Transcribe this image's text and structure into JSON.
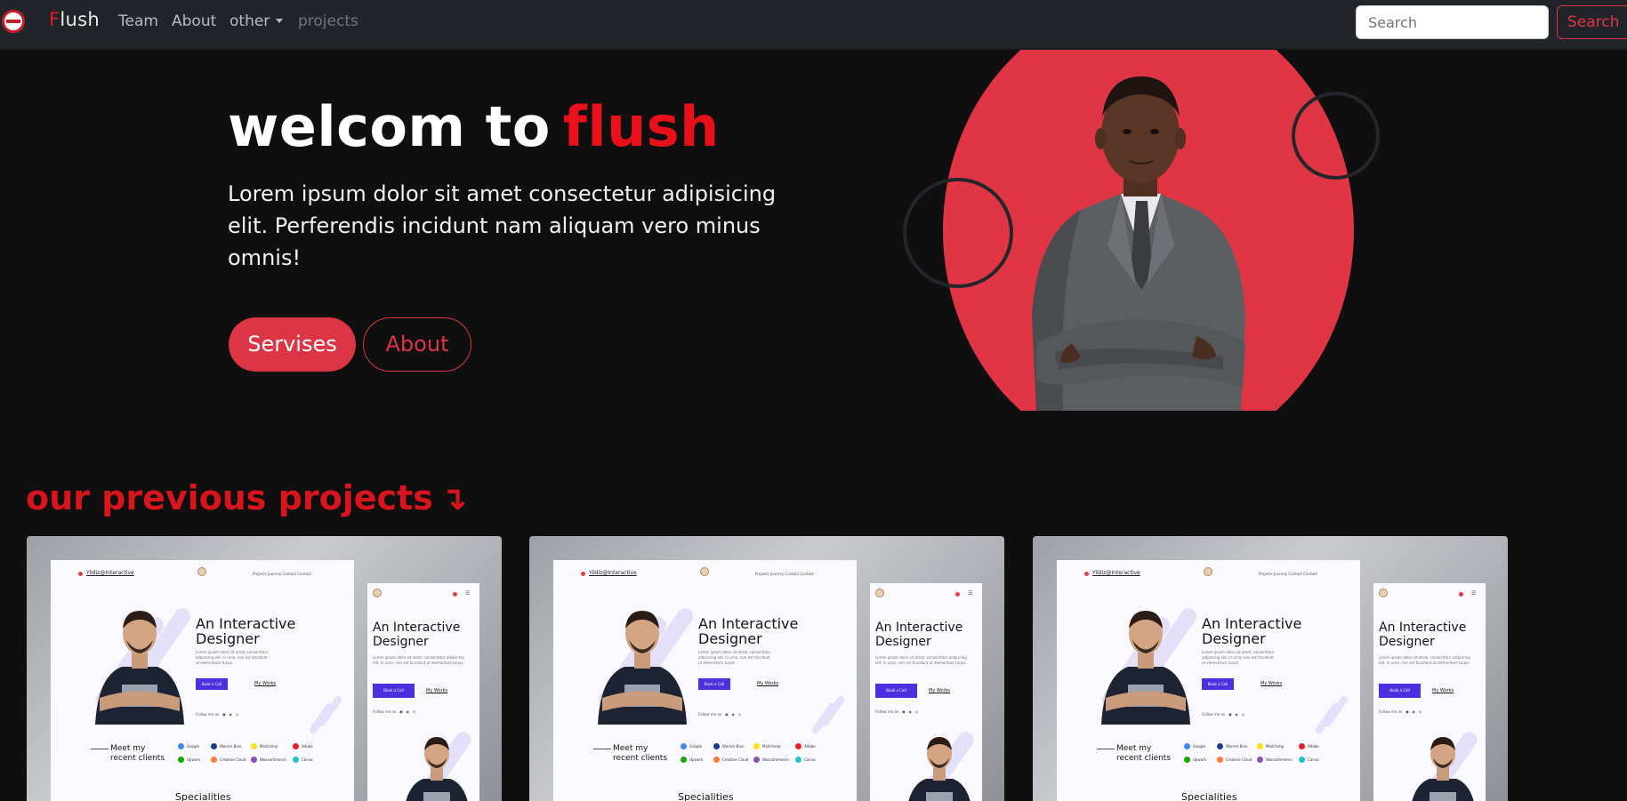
{
  "navbar": {
    "brand_first": "F",
    "brand_rest": "lush",
    "links": [
      "Team",
      "About",
      "other",
      "projects"
    ],
    "search_placeholder": "Search",
    "search_button": "Search"
  },
  "hero": {
    "title_main": "welcom to",
    "title_accent": "flush",
    "text": "Lorem ipsum dolor sit amet consectetur adipisicing elit. Perferendis incidunt nam aliquam vero minus omnis!",
    "primary_button": "Servises",
    "secondary_button": "About"
  },
  "projects": {
    "title": "our previous projects",
    "arrow": "↴",
    "card": {
      "logo": "Yildiz@Interactive",
      "nav": "Projects    Journey    Contact    Contact",
      "headline_1": "An Interactive",
      "headline_2": "Designer",
      "para": "Lorem ipsum dolor sit amet, consectetur adipiscing elit. In urna, non est tincidunt ut elementum turpis.",
      "book_button": "Book a Call",
      "works_link": "My Works",
      "follow": "Follow me on",
      "clients_1": "Meet my",
      "clients_2": "recent clients",
      "brands_row1": [
        "Google",
        "Warner Bros",
        "Mailchimp",
        "Adobe"
      ],
      "brands_row2": [
        "Upwork",
        "Creative Cloud",
        "Woocommerce",
        "Canva"
      ],
      "specialities": "Specialities"
    }
  },
  "colors": {
    "accent_red": "#dc3545",
    "title_red": "#e8101a",
    "mock_purple": "#4d2fe0"
  }
}
